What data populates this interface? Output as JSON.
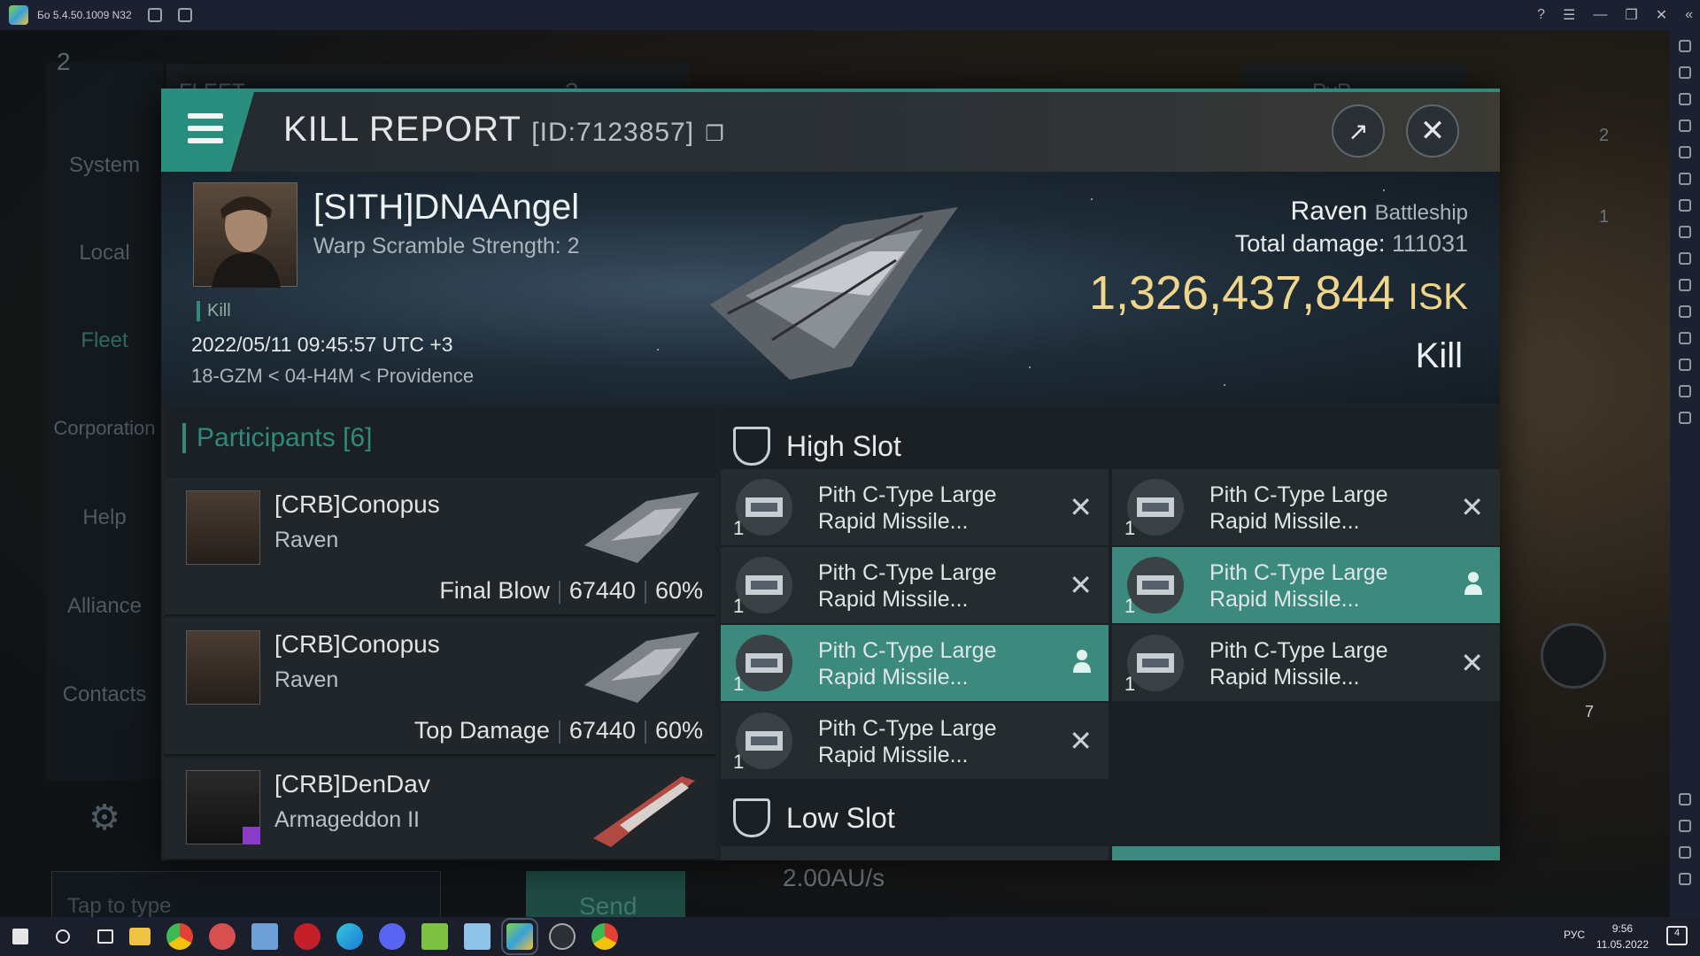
{
  "emulator": {
    "title": "Бо 5.4.50.1009 N32"
  },
  "game": {
    "fleet_count": "2",
    "fleet_title": "FLEET",
    "fleet_box_count": "3",
    "pvp_label": "PvP",
    "nav": [
      "System",
      "Local",
      "Fleet",
      "Corporation",
      "Help",
      "Alliance",
      "Contacts"
    ],
    "chat_placeholder": "Tap to type",
    "send_label": "Send",
    "speed": "2.00AU/s",
    "right_counts": [
      "2",
      "1"
    ],
    "drone_count": "7"
  },
  "report": {
    "title": "KILL REPORT",
    "id": "[ID:7123857]",
    "victim": {
      "name": "[SITH]DNAAngel",
      "scramble": "Warp Scramble Strength: 2",
      "tag": "Kill",
      "time": "2022/05/11 09:45:57 UTC +3",
      "location": "18-GZM < 04-H4M < Providence"
    },
    "ship_name": "Raven",
    "ship_class": "Battleship",
    "total_damage_label": "Total damage:",
    "total_damage": "111031",
    "isk_value": "1,326,437,844",
    "isk_unit": "ISK",
    "kill_type": "Kill"
  },
  "participants": {
    "title": "Participants",
    "count": "[6]",
    "rows": [
      {
        "name": "[CRB]Conopus",
        "ship": "Raven",
        "role": "Final Blow",
        "damage": "67440",
        "pct": "60%"
      },
      {
        "name": "[CRB]Conopus",
        "ship": "Raven",
        "role": "Top Damage",
        "damage": "67440",
        "pct": "60%"
      },
      {
        "name": "[CRB]DenDav",
        "ship": "Armageddon II",
        "role": "",
        "damage": "",
        "pct": ""
      }
    ]
  },
  "slots": {
    "high_title": "High Slot",
    "low_title": "Low Slot",
    "modules": [
      {
        "name": "Pith C-Type Large Rapid Missile...",
        "qty": "1",
        "status": "destroyed"
      },
      {
        "name": "Pith C-Type Large Rapid Missile...",
        "qty": "1",
        "status": "destroyed"
      },
      {
        "name": "Pith C-Type Large Rapid Missile...",
        "qty": "1",
        "status": "destroyed"
      },
      {
        "name": "Pith C-Type Large Rapid Missile...",
        "qty": "1",
        "status": "dropped"
      },
      {
        "name": "Pith C-Type Large Rapid Missile...",
        "qty": "1",
        "status": "dropped"
      },
      {
        "name": "Pith C-Type Large Rapid Missile...",
        "qty": "1",
        "status": "destroyed"
      },
      {
        "name": "Pith C-Type Large Rapid Missile...",
        "qty": "1",
        "status": "destroyed"
      }
    ]
  },
  "taskbar": {
    "lang": "РУС",
    "time": "9:56",
    "date": "11.05.2022",
    "notif_count": "4"
  },
  "colors": {
    "accent": "#2e8b7b",
    "isk": "#f0d68a",
    "selected": "#3c8a7d"
  }
}
